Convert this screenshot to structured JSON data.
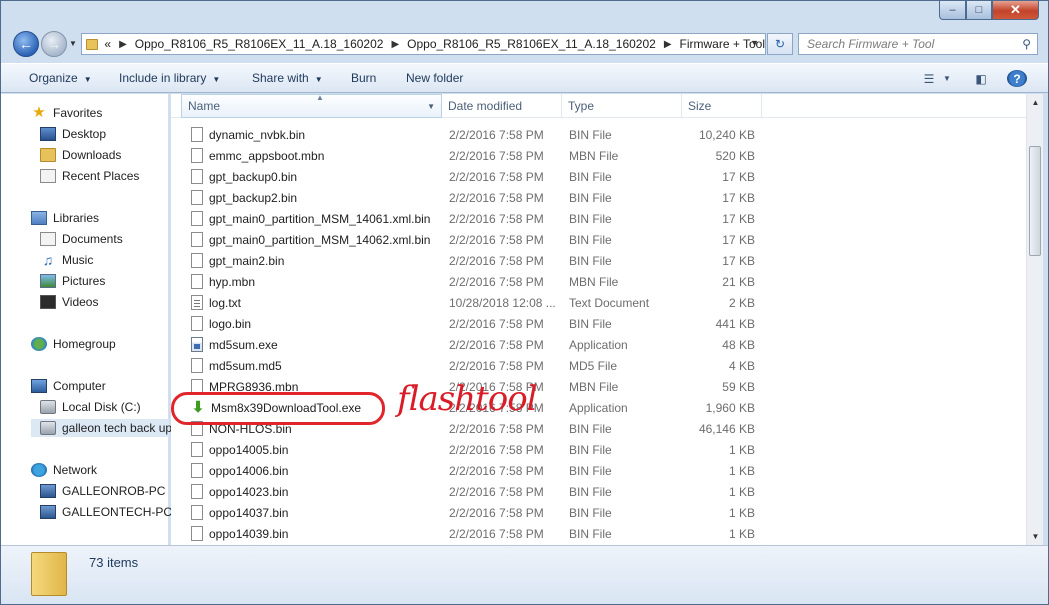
{
  "address": {
    "prefix": "«",
    "crumbs": [
      "Oppo_R8106_R5_R8106EX_11_A.18_160202",
      "Oppo_R8106_R5_R8106EX_11_A.18_160202",
      "Firmware + Tool"
    ]
  },
  "search": {
    "placeholder": "Search Firmware + Tool"
  },
  "toolbar": {
    "organize": "Organize",
    "include_in_library": "Include in library",
    "share_with": "Share with",
    "burn": "Burn",
    "new_folder": "New folder"
  },
  "nav": {
    "favorites": "Favorites",
    "desktop": "Desktop",
    "downloads": "Downloads",
    "recent_places": "Recent Places",
    "libraries": "Libraries",
    "documents": "Documents",
    "music": "Music",
    "pictures": "Pictures",
    "videos": "Videos",
    "homegroup": "Homegroup",
    "computer": "Computer",
    "local_disk": "Local Disk (C:)",
    "galleon_drive": "galleon tech back up",
    "network": "Network",
    "pc1": "GALLEONROB-PC",
    "pc2": "GALLEONTECH-PC"
  },
  "columns": {
    "name": "Name",
    "date": "Date modified",
    "type": "Type",
    "size": "Size"
  },
  "files": [
    {
      "name": "dynamic_nvbk.bin",
      "date": "2/2/2016 7:58 PM",
      "type": "BIN File",
      "size": "10,240 KB",
      "icon": "file"
    },
    {
      "name": "emmc_appsboot.mbn",
      "date": "2/2/2016 7:58 PM",
      "type": "MBN File",
      "size": "520 KB",
      "icon": "file"
    },
    {
      "name": "gpt_backup0.bin",
      "date": "2/2/2016 7:58 PM",
      "type": "BIN File",
      "size": "17 KB",
      "icon": "file"
    },
    {
      "name": "gpt_backup2.bin",
      "date": "2/2/2016 7:58 PM",
      "type": "BIN File",
      "size": "17 KB",
      "icon": "file"
    },
    {
      "name": "gpt_main0_partition_MSM_14061.xml.bin",
      "date": "2/2/2016 7:58 PM",
      "type": "BIN File",
      "size": "17 KB",
      "icon": "file"
    },
    {
      "name": "gpt_main0_partition_MSM_14062.xml.bin",
      "date": "2/2/2016 7:58 PM",
      "type": "BIN File",
      "size": "17 KB",
      "icon": "file"
    },
    {
      "name": "gpt_main2.bin",
      "date": "2/2/2016 7:58 PM",
      "type": "BIN File",
      "size": "17 KB",
      "icon": "file"
    },
    {
      "name": "hyp.mbn",
      "date": "2/2/2016 7:58 PM",
      "type": "MBN File",
      "size": "21 KB",
      "icon": "file"
    },
    {
      "name": "log.txt",
      "date": "10/28/2018 12:08 ...",
      "type": "Text Document",
      "size": "2 KB",
      "icon": "txt"
    },
    {
      "name": "logo.bin",
      "date": "2/2/2016 7:58 PM",
      "type": "BIN File",
      "size": "441 KB",
      "icon": "file"
    },
    {
      "name": "md5sum.exe",
      "date": "2/2/2016 7:58 PM",
      "type": "Application",
      "size": "48 KB",
      "icon": "exe"
    },
    {
      "name": "md5sum.md5",
      "date": "2/2/2016 7:58 PM",
      "type": "MD5 File",
      "size": "4 KB",
      "icon": "file"
    },
    {
      "name": "MPRG8936.mbn",
      "date": "2/2/2016 7:58 PM",
      "type": "MBN File",
      "size": "59 KB",
      "icon": "file"
    },
    {
      "name": "Msm8x39DownloadTool.exe",
      "date": "2/2/2016 7:58 PM",
      "type": "Application",
      "size": "1,960 KB",
      "icon": "download"
    },
    {
      "name": "NON-HLOS.bin",
      "date": "2/2/2016 7:58 PM",
      "type": "BIN File",
      "size": "46,146 KB",
      "icon": "file"
    },
    {
      "name": "oppo14005.bin",
      "date": "2/2/2016 7:58 PM",
      "type": "BIN File",
      "size": "1 KB",
      "icon": "file"
    },
    {
      "name": "oppo14006.bin",
      "date": "2/2/2016 7:58 PM",
      "type": "BIN File",
      "size": "1 KB",
      "icon": "file"
    },
    {
      "name": "oppo14023.bin",
      "date": "2/2/2016 7:58 PM",
      "type": "BIN File",
      "size": "1 KB",
      "icon": "file"
    },
    {
      "name": "oppo14037.bin",
      "date": "2/2/2016 7:58 PM",
      "type": "BIN File",
      "size": "1 KB",
      "icon": "file"
    },
    {
      "name": "oppo14039.bin",
      "date": "2/2/2016 7:58 PM",
      "type": "BIN File",
      "size": "1 KB",
      "icon": "file"
    }
  ],
  "status": {
    "item_count": "73 items"
  },
  "annotation": {
    "label": "flashtool",
    "color": "#e0262a"
  }
}
